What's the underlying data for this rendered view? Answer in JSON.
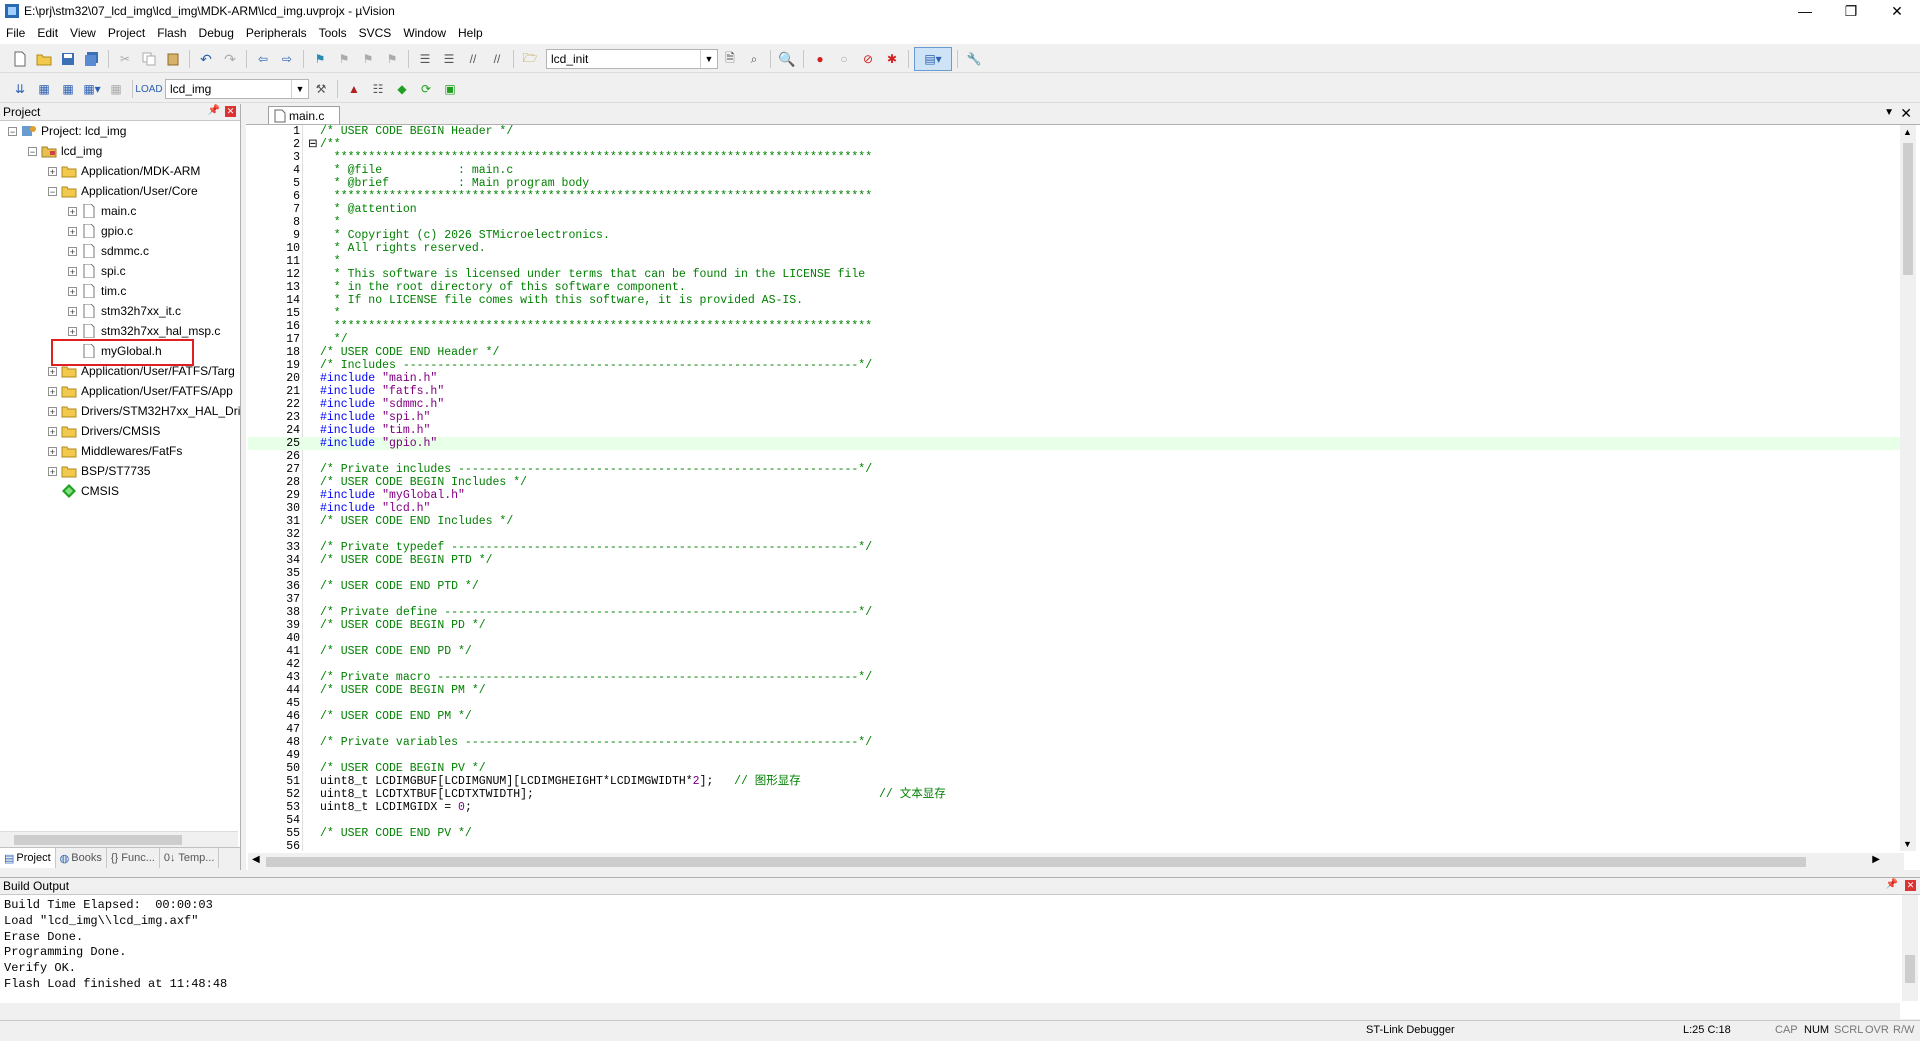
{
  "window": {
    "title": "E:\\prj\\stm32\\07_lcd_img\\lcd_img\\MDK-ARM\\lcd_img.uvprojx - µVision",
    "minimize": "—",
    "maximize": "❐",
    "close": "✕"
  },
  "menu": [
    "File",
    "Edit",
    "View",
    "Project",
    "Flash",
    "Debug",
    "Peripherals",
    "Tools",
    "SVCS",
    "Window",
    "Help"
  ],
  "toolbar": {
    "find_combo_value": "lcd_init",
    "target_combo_value": "lcd_img"
  },
  "project_panel": {
    "title": "Project",
    "tree": [
      {
        "label": "Project: lcd_img",
        "level": 0,
        "expander": "−",
        "icon": "project-icon"
      },
      {
        "label": "lcd_img",
        "level": 1,
        "expander": "−",
        "icon": "target-icon"
      },
      {
        "label": "Application/MDK-ARM",
        "level": 2,
        "expander": "+",
        "icon": "folder-icon"
      },
      {
        "label": "Application/User/Core",
        "level": 2,
        "expander": "−",
        "icon": "folder-icon"
      },
      {
        "label": "main.c",
        "level": 3,
        "expander": "+",
        "icon": "file-icon"
      },
      {
        "label": "gpio.c",
        "level": 3,
        "expander": "+",
        "icon": "file-icon"
      },
      {
        "label": "sdmmc.c",
        "level": 3,
        "expander": "+",
        "icon": "file-icon"
      },
      {
        "label": "spi.c",
        "level": 3,
        "expander": "+",
        "icon": "file-icon"
      },
      {
        "label": "tim.c",
        "level": 3,
        "expander": "+",
        "icon": "file-icon"
      },
      {
        "label": "stm32h7xx_it.c",
        "level": 3,
        "expander": "+",
        "icon": "file-icon"
      },
      {
        "label": "stm32h7xx_hal_msp.c",
        "level": 3,
        "expander": "+",
        "icon": "file-icon"
      },
      {
        "label": "myGlobal.h",
        "level": 3,
        "expander": "",
        "icon": "file-icon"
      },
      {
        "label": "Application/User/FATFS/Targ",
        "level": 2,
        "expander": "+",
        "icon": "folder-icon"
      },
      {
        "label": "Application/User/FATFS/App",
        "level": 2,
        "expander": "+",
        "icon": "folder-icon"
      },
      {
        "label": "Drivers/STM32H7xx_HAL_Dri",
        "level": 2,
        "expander": "+",
        "icon": "folder-icon"
      },
      {
        "label": "Drivers/CMSIS",
        "level": 2,
        "expander": "+",
        "icon": "folder-icon"
      },
      {
        "label": "Middlewares/FatFs",
        "level": 2,
        "expander": "+",
        "icon": "folder-icon"
      },
      {
        "label": "BSP/ST7735",
        "level": 2,
        "expander": "+",
        "icon": "folder-icon"
      },
      {
        "label": "CMSIS",
        "level": 2,
        "expander": "",
        "icon": "cmsis-icon"
      }
    ],
    "tabs": [
      "Project",
      "Books",
      "{} Func...",
      "0↓ Temp..."
    ]
  },
  "editor": {
    "tab_label": "main.c",
    "cursor_line": 25,
    "lines": [
      {
        "n": "1",
        "t": "/* USER CODE BEGIN Header */",
        "k": "cmt"
      },
      {
        "n": "2",
        "t": "/**",
        "k": "cmt",
        "fold": "⊟"
      },
      {
        "n": "3",
        "t": "  ******************************************************************************",
        "k": "cmt"
      },
      {
        "n": "4",
        "t": "  * @file           : main.c",
        "k": "cmt"
      },
      {
        "n": "5",
        "t": "  * @brief          : Main program body",
        "k": "cmt"
      },
      {
        "n": "6",
        "t": "  ******************************************************************************",
        "k": "cmt"
      },
      {
        "n": "7",
        "t": "  * @attention",
        "k": "cmt"
      },
      {
        "n": "8",
        "t": "  *",
        "k": "cmt"
      },
      {
        "n": "9",
        "t": "  * Copyright (c) 2026 STMicroelectronics.",
        "k": "cmt"
      },
      {
        "n": "10",
        "t": "  * All rights reserved.",
        "k": "cmt"
      },
      {
        "n": "11",
        "t": "  *",
        "k": "cmt"
      },
      {
        "n": "12",
        "t": "  * This software is licensed under terms that can be found in the LICENSE file",
        "k": "cmt"
      },
      {
        "n": "13",
        "t": "  * in the root directory of this software component.",
        "k": "cmt"
      },
      {
        "n": "14",
        "t": "  * If no LICENSE file comes with this software, it is provided AS-IS.",
        "k": "cmt"
      },
      {
        "n": "15",
        "t": "  *",
        "k": "cmt"
      },
      {
        "n": "16",
        "t": "  ******************************************************************************",
        "k": "cmt"
      },
      {
        "n": "17",
        "t": "  */",
        "k": "cmt"
      },
      {
        "n": "18",
        "t": "/* USER CODE END Header */",
        "k": "cmt"
      },
      {
        "n": "19",
        "t": "/* Includes ------------------------------------------------------------------*/",
        "k": "cmt"
      },
      {
        "n": "20",
        "t": "#include ",
        "s": "\"main.h\"",
        "k": "pre"
      },
      {
        "n": "21",
        "t": "#include ",
        "s": "\"fatfs.h\"",
        "k": "pre"
      },
      {
        "n": "22",
        "t": "#include ",
        "s": "\"sdmmc.h\"",
        "k": "pre"
      },
      {
        "n": "23",
        "t": "#include ",
        "s": "\"spi.h\"",
        "k": "pre"
      },
      {
        "n": "24",
        "t": "#include ",
        "s": "\"tim.h\"",
        "k": "pre"
      },
      {
        "n": "25",
        "t": "#include ",
        "s": "\"gpio.h\"",
        "k": "pre"
      },
      {
        "n": "26",
        "t": "",
        "k": "plain"
      },
      {
        "n": "27",
        "t": "/* Private includes ----------------------------------------------------------*/",
        "k": "cmt"
      },
      {
        "n": "28",
        "t": "/* USER CODE BEGIN Includes */",
        "k": "cmt"
      },
      {
        "n": "29",
        "t": "#include ",
        "s": "\"myGlobal.h\"",
        "k": "pre"
      },
      {
        "n": "30",
        "t": "#include ",
        "s": "\"lcd.h\"",
        "k": "pre"
      },
      {
        "n": "31",
        "t": "/* USER CODE END Includes */",
        "k": "cmt"
      },
      {
        "n": "32",
        "t": "",
        "k": "plain"
      },
      {
        "n": "33",
        "t": "/* Private typedef -----------------------------------------------------------*/",
        "k": "cmt"
      },
      {
        "n": "34",
        "t": "/* USER CODE BEGIN PTD */",
        "k": "cmt"
      },
      {
        "n": "35",
        "t": "",
        "k": "plain"
      },
      {
        "n": "36",
        "t": "/* USER CODE END PTD */",
        "k": "cmt"
      },
      {
        "n": "37",
        "t": "",
        "k": "plain"
      },
      {
        "n": "38",
        "t": "/* Private define ------------------------------------------------------------*/",
        "k": "cmt"
      },
      {
        "n": "39",
        "t": "/* USER CODE BEGIN PD */",
        "k": "cmt"
      },
      {
        "n": "40",
        "t": "",
        "k": "plain"
      },
      {
        "n": "41",
        "t": "/* USER CODE END PD */",
        "k": "cmt"
      },
      {
        "n": "42",
        "t": "",
        "k": "plain"
      },
      {
        "n": "43",
        "t": "/* Private macro -------------------------------------------------------------*/",
        "k": "cmt"
      },
      {
        "n": "44",
        "t": "/* USER CODE BEGIN PM */",
        "k": "cmt"
      },
      {
        "n": "45",
        "t": "",
        "k": "plain"
      },
      {
        "n": "46",
        "t": "/* USER CODE END PM */",
        "k": "cmt"
      },
      {
        "n": "47",
        "t": "",
        "k": "plain"
      },
      {
        "n": "48",
        "t": "/* Private variables ---------------------------------------------------------*/",
        "k": "cmt"
      },
      {
        "n": "49",
        "t": "",
        "k": "plain"
      },
      {
        "n": "50",
        "t": "/* USER CODE BEGIN PV */",
        "k": "cmt"
      },
      {
        "n": "51",
        "t": "uint8_t LCDIMGBUF[LCDIMGNUM][LCDIMGHEIGHT*LCDIMGWIDTH*",
        "s2": "2",
        "t2": "];   ",
        "c": "// 图形显存",
        "k": "code"
      },
      {
        "n": "52",
        "t": "uint8_t LCDTXTBUF[LCDTXTWIDTH];                                                  ",
        "c": "// 文本显存",
        "k": "code"
      },
      {
        "n": "53",
        "t": "uint8_t LCDIMGIDX = ",
        "s2": "0",
        "t2": ";",
        "k": "code"
      },
      {
        "n": "54",
        "t": "",
        "k": "plain"
      },
      {
        "n": "55",
        "t": "/* USER CODE END PV */",
        "k": "cmt"
      },
      {
        "n": "56",
        "t": "",
        "k": "plain"
      }
    ]
  },
  "build_output": {
    "title": "Build Output",
    "lines": [
      "Build Time Elapsed:  00:00:03",
      "Load \"lcd_img\\\\lcd_img.axf\"",
      "Erase Done.",
      "Programming Done.",
      "Verify OK.",
      "Flash Load finished at 11:48:48"
    ]
  },
  "status": {
    "debugger": "ST-Link Debugger",
    "position": "L:25 C:18",
    "cap": "CAP",
    "num": "NUM",
    "scrl": "SCRL",
    "ovr": "OVR",
    "rw": "R/W"
  },
  "colors": {
    "comment": "#008000",
    "preprocessor": "#0000ff",
    "string": "#800080",
    "highlight_box": "#e02020"
  }
}
